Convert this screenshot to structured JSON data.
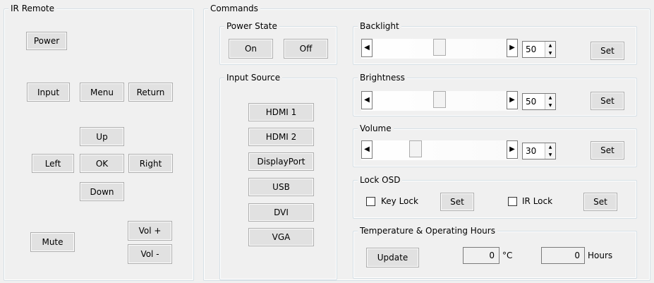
{
  "ir_remote": {
    "title": "IR Remote",
    "power": "Power",
    "input": "Input",
    "menu": "Menu",
    "return": "Return",
    "up": "Up",
    "left": "Left",
    "ok": "OK",
    "right": "Right",
    "down": "Down",
    "mute": "Mute",
    "vol_up": "Vol +",
    "vol_down": "Vol -"
  },
  "commands": {
    "title": "Commands",
    "power_state": {
      "title": "Power State",
      "on": "On",
      "off": "Off"
    },
    "input_source": {
      "title": "Input Source",
      "options": [
        "HDMI 1",
        "HDMI 2",
        "DisplayPort",
        "USB",
        "DVI",
        "VGA"
      ]
    },
    "backlight": {
      "title": "Backlight",
      "value": 50,
      "set_label": "Set"
    },
    "brightness": {
      "title": "Brightness",
      "value": 50,
      "set_label": "Set"
    },
    "volume": {
      "title": "Volume",
      "value": 30,
      "set_label": "Set"
    },
    "lock_osd": {
      "title": "Lock OSD",
      "key_lock_label": "Key Lock",
      "key_lock_checked": false,
      "ir_lock_label": "IR Lock",
      "ir_lock_checked": false,
      "set_label": "Set"
    },
    "temp_hours": {
      "title": "Temperature & Operating Hours",
      "update_label": "Update",
      "temperature_value": "0",
      "temperature_unit": "°C",
      "hours_value": "0",
      "hours_unit": "Hours"
    }
  },
  "icons": {
    "arrow_left": "◀",
    "arrow_right": "▶",
    "spin_up": "▲",
    "spin_down": "▼"
  }
}
